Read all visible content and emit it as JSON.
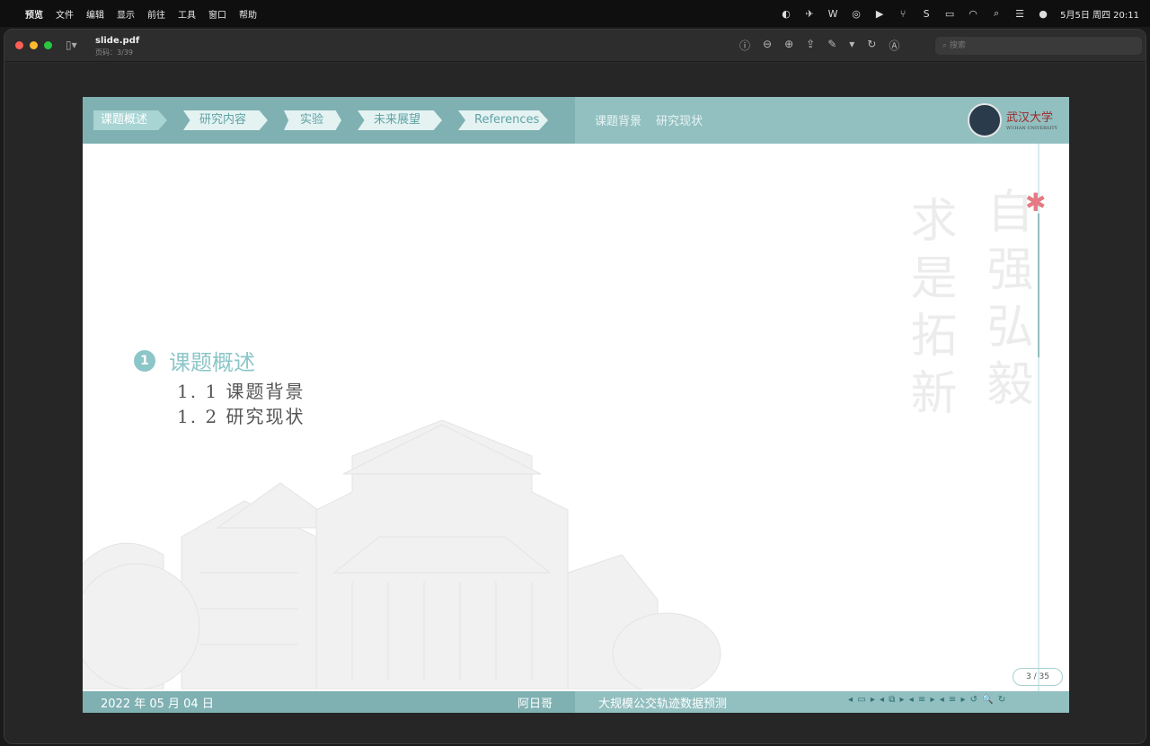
{
  "menubar": {
    "apple": "",
    "items": [
      "预览",
      "文件",
      "编辑",
      "显示",
      "前往",
      "工具",
      "窗口",
      "帮助"
    ],
    "datetime": "5月5日 周四 20:11"
  },
  "window": {
    "title": "slide.pdf",
    "subtitle": "页码：3/39",
    "search_placeholder": "搜索"
  },
  "slide": {
    "nav_tabs": [
      "课题概述",
      "研究内容",
      "实验",
      "未来展望",
      "References"
    ],
    "sub_links": [
      "课题背景",
      "研究现状"
    ],
    "logo_text": "武汉大学",
    "logo_sub": "WUHAN UNIVERSITY",
    "toc": {
      "number": "1",
      "title": "课题概述",
      "items": [
        "1. 1 课题背景",
        "1. 2 研究现状"
      ]
    },
    "motto": [
      "自强弘毅",
      "求是拓新"
    ],
    "page_badge": "3 / 35",
    "footer": {
      "date": "2022 年 05 月 04 日",
      "author": "阿日哥",
      "title": "大规模公交轨迹数据预测",
      "nav": "◂ ▭ ▸ ◂ ⧉ ▸ ◂ ≡ ▸ ◂ ≡ ▸ ↺ 🔍 ↻"
    },
    "colors": {
      "accent": "#92bfc0",
      "accent_dark": "#7fb0b2",
      "flower": "#e57a84"
    }
  }
}
